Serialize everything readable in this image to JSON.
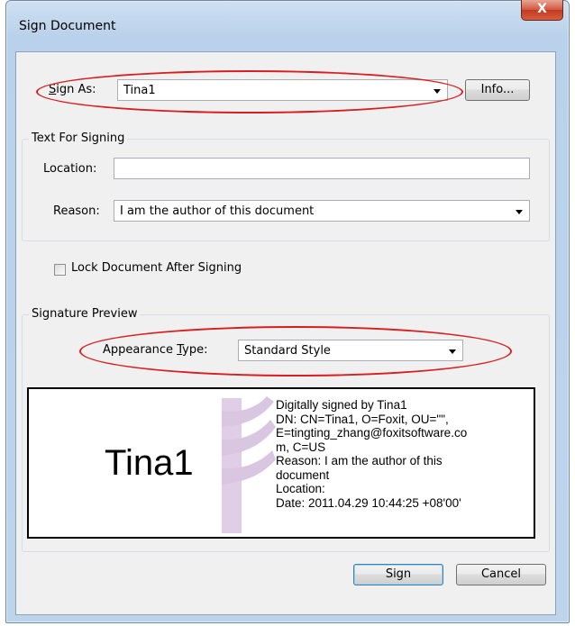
{
  "window": {
    "title": "Sign Document",
    "close_glyph": "X"
  },
  "sign_as": {
    "label": "Sign As:",
    "value": "Tina1",
    "info_button": "Info..."
  },
  "text_for_signing": {
    "legend": "Text For Signing",
    "location_label": "Location:",
    "location_value": "",
    "reason_label": "Reason:",
    "reason_value": "I am the author of this document"
  },
  "lock_document": {
    "label": "Lock Document After Signing",
    "checked": false
  },
  "signature_preview": {
    "legend": "Signature Preview",
    "appearance_label": "Appearance Type:",
    "appearance_value": "Standard Style",
    "name": "Tina1",
    "details": [
      "Digitally signed by Tina1",
      "DN: CN=Tina1, O=Foxit, OU=\"\",",
      "E=tingting_zhang@foxitsoftware.co",
      "m, C=US",
      "Reason: I am the author of this",
      "document",
      "Location:",
      "Date: 2011.04.29 10:44:25 +08'00'"
    ]
  },
  "buttons": {
    "sign": "Sign",
    "cancel": "Cancel"
  },
  "colors": {
    "annotation_ellipse": "#d81e1e",
    "watermark": "#d9c6e0"
  }
}
